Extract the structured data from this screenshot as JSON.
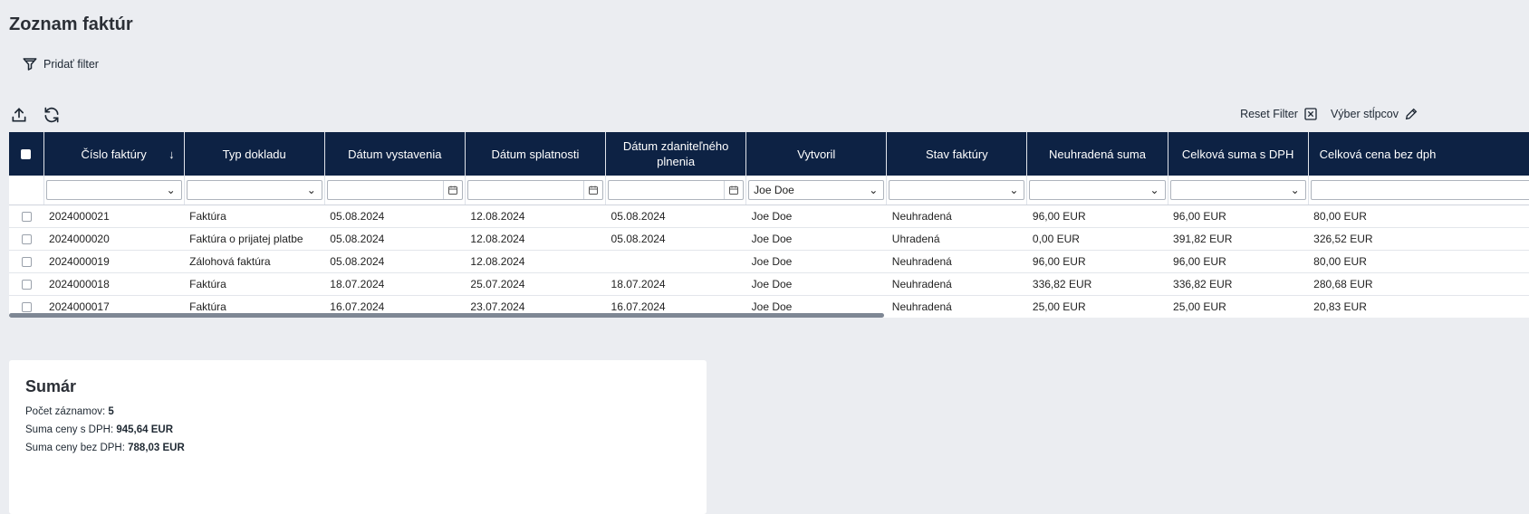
{
  "page_title": "Zoznam faktúr",
  "add_filter_label": "Pridať filter",
  "toolbar": {
    "export_icon": "upload-icon",
    "refresh_icon": "refresh-icon",
    "reset_filter_label": "Reset Filter",
    "column_select_label": "Výber stĺpcov"
  },
  "columns": [
    "Číslo faktúry",
    "Typ dokladu",
    "Dátum vystavenia",
    "Dátum splatnosti",
    "Dátum zdaniteľného plnenia",
    "Vytvoril",
    "Stav faktúry",
    "Neuhradená suma",
    "Celková suma s DPH",
    "Celková cena bez dph"
  ],
  "filters": {
    "vytvoril": "Joe Doe"
  },
  "rows": [
    [
      "2024000021",
      "Faktúra",
      "05.08.2024",
      "12.08.2024",
      "05.08.2024",
      "Joe Doe",
      "Neuhradená",
      "96,00 EUR",
      "96,00 EUR",
      "80,00 EUR"
    ],
    [
      "2024000020",
      "Faktúra o prijatej platbe",
      "05.08.2024",
      "12.08.2024",
      "05.08.2024",
      "Joe Doe",
      "Uhradená",
      "0,00 EUR",
      "391,82 EUR",
      "326,52 EUR"
    ],
    [
      "2024000019",
      "Zálohová faktúra",
      "05.08.2024",
      "12.08.2024",
      "",
      "Joe Doe",
      "Neuhradená",
      "96,00 EUR",
      "96,00 EUR",
      "80,00 EUR"
    ],
    [
      "2024000018",
      "Faktúra",
      "18.07.2024",
      "25.07.2024",
      "18.07.2024",
      "Joe Doe",
      "Neuhradená",
      "336,82 EUR",
      "336,82 EUR",
      "280,68 EUR"
    ],
    [
      "2024000017",
      "Faktúra",
      "16.07.2024",
      "23.07.2024",
      "16.07.2024",
      "Joe Doe",
      "Neuhradená",
      "25,00 EUR",
      "25,00 EUR",
      "20,83 EUR"
    ]
  ],
  "summary": {
    "title": "Sumár",
    "count_label": "Počet záznamov:",
    "count_value": "5",
    "with_vat_label": "Suma ceny s DPH:",
    "with_vat_value": "945,64 EUR",
    "without_vat_label": "Suma ceny bez DPH:",
    "without_vat_value": "788,03 EUR"
  },
  "colors": {
    "header_bg": "#0d2244",
    "page_bg": "#ebedf1"
  }
}
